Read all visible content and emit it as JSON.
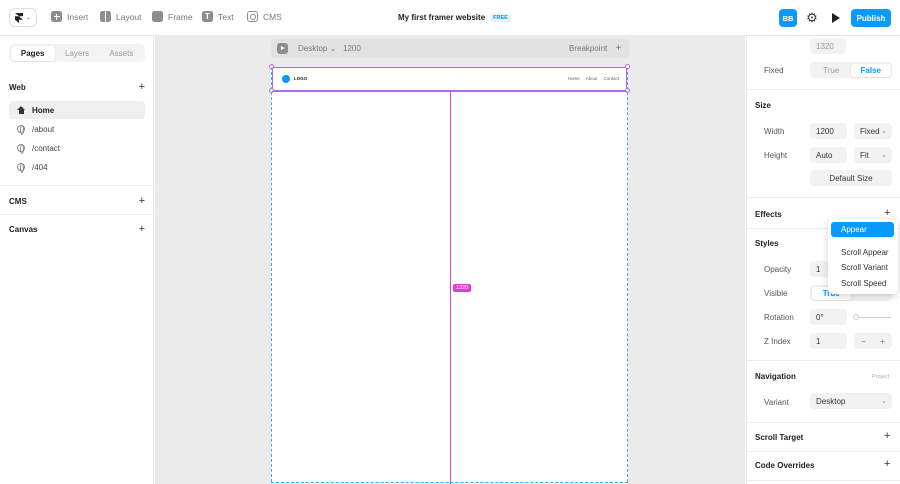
{
  "toolbar": {
    "insert_label": "Insert",
    "layout_label": "Layout",
    "frame_label": "Frame",
    "text_label": "Text",
    "cms_label": "CMS",
    "site_title": "My first framer website",
    "plan_badge": "FREE",
    "avatar_initials": "BB",
    "publish_label": "Publish"
  },
  "left_panel": {
    "tabs": [
      {
        "label": "Pages",
        "active": true
      },
      {
        "label": "Layers",
        "active": false
      },
      {
        "label": "Assets",
        "active": false
      }
    ],
    "web_section": "Web",
    "pages": [
      {
        "label": "Home",
        "icon": "home-icon",
        "selected": true
      },
      {
        "label": "/about",
        "icon": "globe-icon",
        "selected": false
      },
      {
        "label": "/contact",
        "icon": "globe-icon",
        "selected": false
      },
      {
        "label": "/404",
        "icon": "globe-icon",
        "selected": false
      }
    ],
    "cms_section": "CMS",
    "canvas_section": "Canvas"
  },
  "canvas": {
    "breakpoint_device": "Desktop",
    "breakpoint_width": "1200",
    "breakpoint_label": "Breakpoint",
    "nav": {
      "logo_text": "LOGO",
      "links": [
        "Home",
        "About",
        "Contact"
      ]
    },
    "size_badge": "1320"
  },
  "right_panel": {
    "top_value": "1320",
    "fixed_label": "Fixed",
    "fixed_options": [
      "True",
      "False"
    ],
    "size_section": "Size",
    "width_label": "Width",
    "width_value": "1200",
    "width_mode": "Fixed",
    "height_label": "Height",
    "height_value": "Auto",
    "height_mode": "Fit",
    "default_size_label": "Default Size",
    "effects_section": "Effects",
    "styles_section": "Styles",
    "opacity_label": "Opacity",
    "opacity_value": "1",
    "visible_label": "Visible",
    "visible_option": "True",
    "rotation_label": "Rotation",
    "rotation_value": "0°",
    "zindex_label": "Z Index",
    "zindex_value": "1",
    "navigation_section": "Navigation",
    "navigation_scope": "Project",
    "variant_label": "Variant",
    "variant_value": "Desktop",
    "scroll_target_section": "Scroll Target",
    "code_overrides_section": "Code Overrides"
  },
  "effects_menu": {
    "items": [
      "Appear",
      "Scroll Appear",
      "Scroll Variant",
      "Scroll Speed"
    ],
    "highlighted": "Appear"
  },
  "colors": {
    "accent": "#0a99ff",
    "selection": "#b06be0",
    "guide": "#d946c8"
  }
}
